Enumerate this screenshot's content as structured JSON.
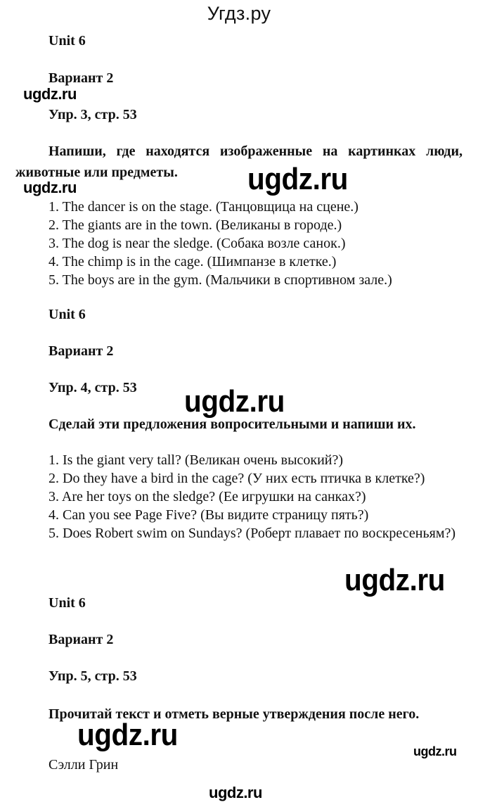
{
  "site_title": "Угдз.ру",
  "watermark": "ugdz.ru",
  "sections": [
    {
      "unit": "Unit 6",
      "variant": "Вариант 2",
      "exercise": "Упр. 3, стр. 53",
      "task": "Напиши, где находятся изображенные на картинках люди, животные или предметы.",
      "answers": [
        "1. The dancer is on the stage. (Танцовщица на сцене.)",
        "2. The giants are in the town. (Великаны в городе.)",
        "3. The dog is near the sledge. (Собака возле санок.)",
        "4. The chimp is in the cage. (Шимпанзе в клетке.)",
        "5. The boys are in the gym. (Мальчики в спортивном зале.)"
      ]
    },
    {
      "unit": "Unit 6",
      "variant": "Вариант 2",
      "exercise": "Упр. 4, стр. 53",
      "task": "Сделай эти предложения вопросительными и напиши их.",
      "answers": [
        "1. Is the giant very tall? (Великан очень высокий?)",
        "2. Do they have a bird in the cage? (У них есть птичка в клетке?)",
        "3. Are her toys on the sledge? (Ее игрушки на санках?)",
        "4. Can you see Page Five? (Вы видите страницу пять?)",
        "5. Does Robert swim on Sundays? (Роберт плавает по воскресеньям?)"
      ]
    },
    {
      "unit": "Unit 6",
      "variant": "Вариант 2",
      "exercise": "Упр. 5, стр. 53",
      "task": "Прочитай текст и отметь верные утверждения после него.",
      "text_title": "Сэлли Грин"
    }
  ]
}
